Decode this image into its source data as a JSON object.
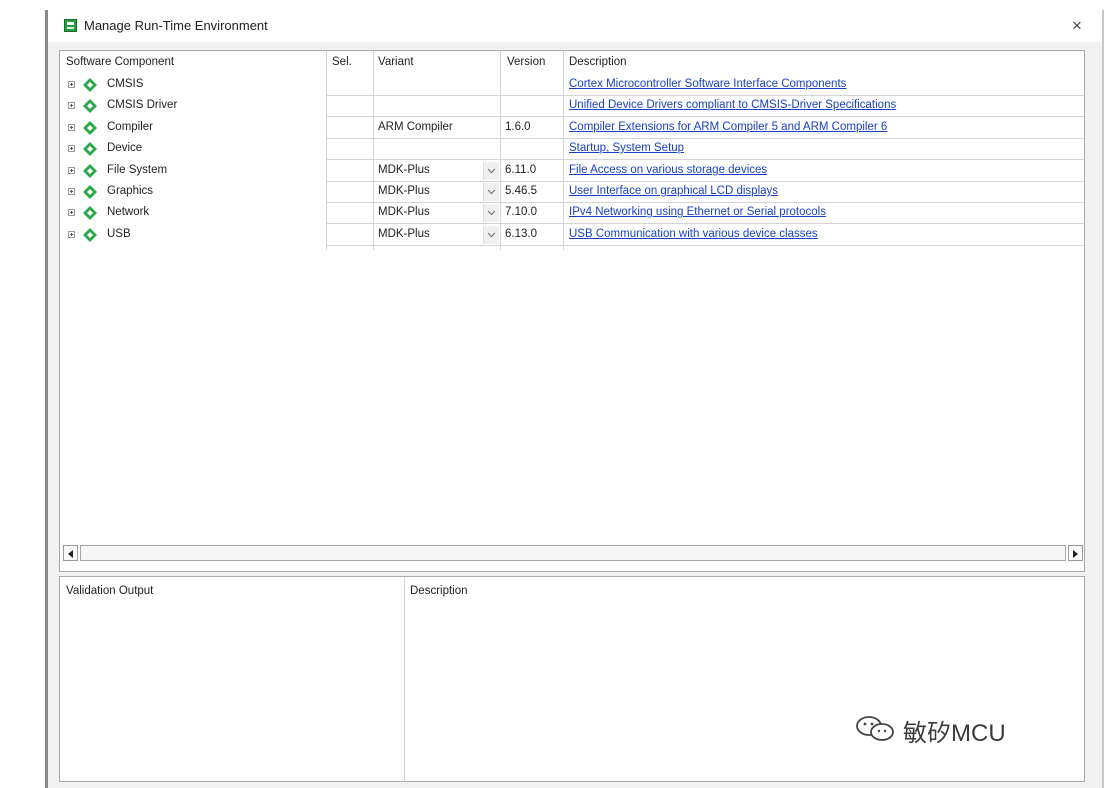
{
  "window": {
    "title": "Manage Run-Time Environment",
    "close_glyph": "×"
  },
  "component_table": {
    "headers": {
      "component": "Software Component",
      "sel": "Sel.",
      "variant": "Variant",
      "version": "Version",
      "description": "Description"
    },
    "rows": [
      {
        "name": "CMSIS",
        "variant": "",
        "has_dropdown": false,
        "version": "",
        "description": "Cortex Microcontroller Software Interface Components",
        "icon": "green-diamond-icon"
      },
      {
        "name": "CMSIS Driver",
        "variant": "",
        "has_dropdown": false,
        "version": "",
        "description": "Unified Device Drivers compliant to CMSIS-Driver Specifications",
        "icon": "green-diamond-icon"
      },
      {
        "name": "Compiler",
        "variant": "ARM Compiler",
        "has_dropdown": false,
        "version": "1.6.0",
        "description": "Compiler Extensions for ARM Compiler 5 and ARM Compiler 6",
        "icon": "green-diamond-icon"
      },
      {
        "name": "Device",
        "variant": "",
        "has_dropdown": false,
        "version": "",
        "description": "Startup, System Setup",
        "icon": "green-diamond-icon"
      },
      {
        "name": "File System",
        "variant": "MDK-Plus",
        "has_dropdown": true,
        "version": "6.11.0",
        "description": "File Access on various storage devices",
        "icon": "green-diamond-icon"
      },
      {
        "name": "Graphics",
        "variant": "MDK-Plus",
        "has_dropdown": true,
        "version": "5.46.5",
        "description": "User Interface on graphical LCD displays",
        "icon": "green-diamond-icon"
      },
      {
        "name": "Network",
        "variant": "MDK-Plus",
        "has_dropdown": true,
        "version": "7.10.0",
        "description": "IPv4 Networking using Ethernet or Serial protocols",
        "icon": "green-diamond-icon"
      },
      {
        "name": "USB",
        "variant": "MDK-Plus",
        "has_dropdown": true,
        "version": "6.13.0",
        "description": "USB Communication with various device classes",
        "icon": "green-diamond-icon"
      }
    ]
  },
  "validation": {
    "headers": {
      "output": "Validation Output",
      "description": "Description"
    }
  },
  "watermark": {
    "text": "敏矽MCU",
    "icon": "wechat-icon"
  },
  "colors": {
    "link": "#1a3fc2",
    "component_icon": "#2aa84a"
  }
}
